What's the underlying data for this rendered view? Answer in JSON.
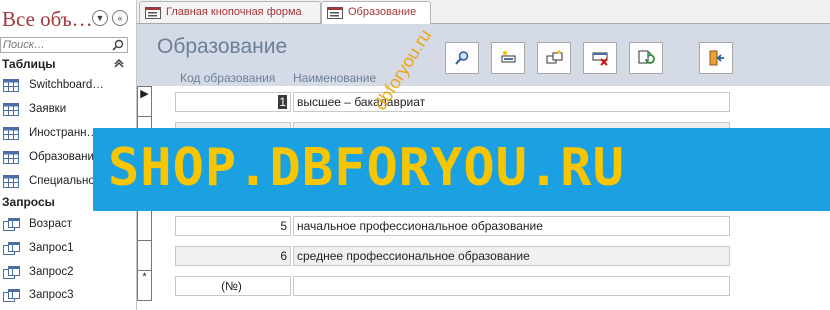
{
  "nav": {
    "title": "Все объ…",
    "search_placeholder": "Поиск…",
    "groups": [
      {
        "label": "Таблицы",
        "items": [
          "Switchboard…",
          "Заявки",
          "Иностранн…",
          "Образовани…",
          "Специально…"
        ]
      },
      {
        "label": "Запросы",
        "items": [
          "Возраст",
          "Запрос1",
          "Запрос2",
          "Запрос3"
        ]
      }
    ]
  },
  "tabs": [
    {
      "label": "Главная кнопочная форма"
    },
    {
      "label": "Образование"
    }
  ],
  "form": {
    "title": "Образование",
    "col_code": "Код образования",
    "col_name": "Наименование",
    "buttons": [
      "search-button",
      "new-record-button",
      "copy-button",
      "delete-button",
      "refresh-button",
      "exit-button"
    ]
  },
  "records": [
    {
      "code": "1",
      "name": "высшее – бакалавриат",
      "selector": "▶"
    },
    {
      "code": "5",
      "name": "начальное профессиональное образование",
      "selector": ""
    },
    {
      "code": "6",
      "name": "среднее профессиональное образование",
      "selector": ""
    },
    {
      "code": "(№)",
      "name": "",
      "selector": "*"
    }
  ],
  "watermark": {
    "banner": "SHOP.DBFORYOU.RU",
    "diagonal": "dbforyou.ru"
  },
  "colors": {
    "accent": "#a4373a",
    "header_bg": "#d4dbe6",
    "banner_bg": "#1ba1e2",
    "banner_text": "#f7c600"
  }
}
